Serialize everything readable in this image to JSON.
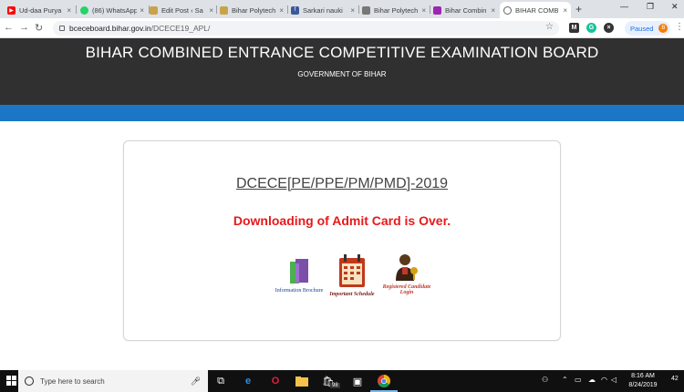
{
  "browser": {
    "tabs": [
      {
        "title": "Ud-daa Purya",
        "icon": "youtube-icon",
        "color": "#ff0000"
      },
      {
        "title": "(86) WhatsApp",
        "icon": "whatsapp-icon",
        "color": "#25d366"
      },
      {
        "title": "Edit Post ‹ Sa",
        "icon": "edit-post-icon",
        "color": "#c9a34a"
      },
      {
        "title": "Bihar Polytech",
        "icon": "bihar-polytechnic-icon",
        "color": "#c9a34a"
      },
      {
        "title": "Sarkari nauki",
        "icon": "facebook-icon",
        "color": "#3b5998"
      },
      {
        "title": "Bihar Polytech",
        "icon": "bihar-polytechnic-icon",
        "color": "#777777"
      },
      {
        "title": "Bihar Combin",
        "icon": "bihar-combined-icon",
        "color": "#9c27b0"
      },
      {
        "title": "BIHAR COMB",
        "icon": "globe-icon",
        "color": "#5f6368"
      }
    ],
    "active_tab_index": 7,
    "url_domain": "bceceboard.bihar.gov.in",
    "url_path": "/DCECE19_APL/",
    "profile_label": "Paused",
    "profile_initial": "B"
  },
  "header": {
    "title": "BIHAR COMBINED ENTRANCE COMPETITIVE EXAMINATION BOARD",
    "subtitle": "GOVERNMENT OF BIHAR"
  },
  "main": {
    "exam_title": "DCECE[PE/PPE/PM/PMD]-2019",
    "notice": "Downloading of Admit Card is Over.",
    "links": {
      "brochure": "Information Brochure",
      "schedule": "Important Schedule",
      "login_line1": "Registered Candidate",
      "login_line2": "Login"
    }
  },
  "taskbar": {
    "search_placeholder": "Type here to search",
    "store_badge": "98",
    "time": "8:16 AM",
    "date": "8/24/2019",
    "notification_count": "42"
  },
  "colors": {
    "header_bg": "#303030",
    "band": "#1b77c5",
    "notice": "#e8191b"
  }
}
